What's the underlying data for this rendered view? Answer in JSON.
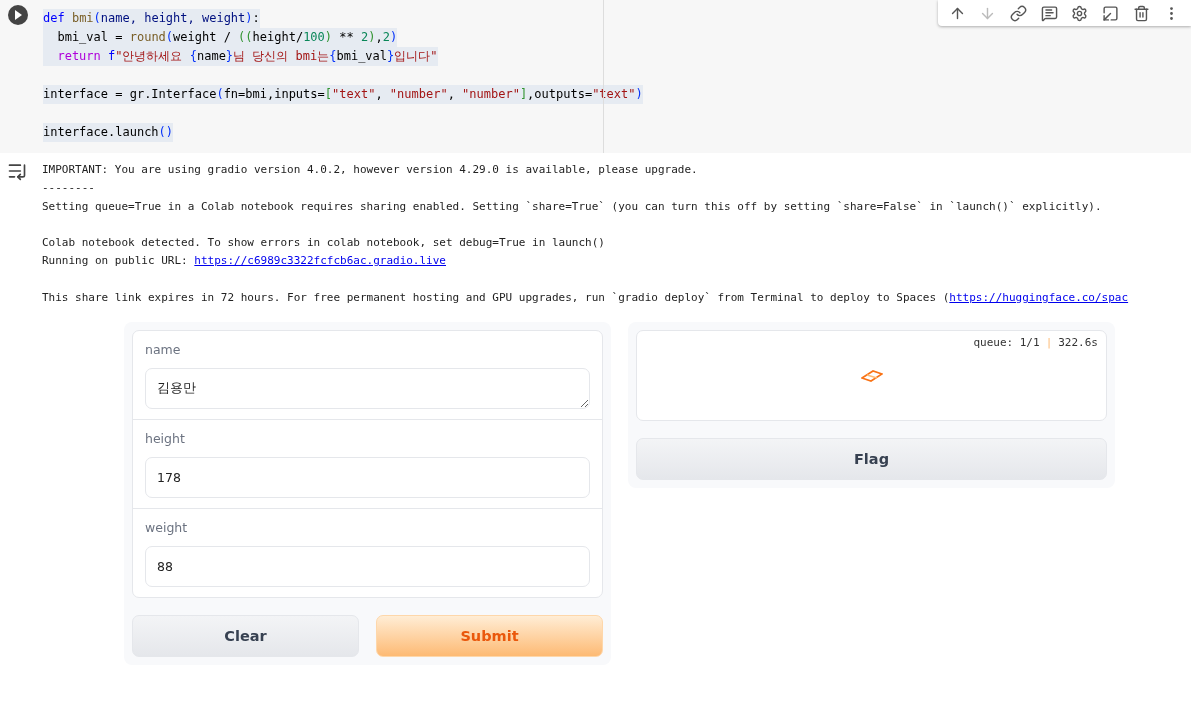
{
  "cell": {
    "code_blocks": [
      {
        "lines": [
          {
            "tokens": [
              {
                "text": "def ",
                "kind": "kw"
              },
              {
                "text": "bmi",
                "kind": "fn"
              },
              {
                "text": "(",
                "kind": "br"
              },
              {
                "text": "name, height, weight",
                "kind": "pm"
              },
              {
                "text": ")",
                "kind": "br"
              },
              {
                "text": ":",
                "kind": "tx"
              }
            ]
          },
          {
            "tokens": [
              {
                "text": "  bmi_val = ",
                "kind": "tx"
              },
              {
                "text": "round",
                "kind": "fn"
              },
              {
                "text": "(",
                "kind": "br"
              },
              {
                "text": "weight / ",
                "kind": "tx"
              },
              {
                "text": "((",
                "kind": "br2"
              },
              {
                "text": "height/",
                "kind": "tx"
              },
              {
                "text": "100",
                "kind": "num"
              },
              {
                "text": ")",
                "kind": "br2"
              },
              {
                "text": " ** ",
                "kind": "tx"
              },
              {
                "text": "2",
                "kind": "num"
              },
              {
                "text": ")",
                "kind": "br2"
              },
              {
                "text": ",",
                "kind": "tx"
              },
              {
                "text": "2",
                "kind": "num"
              },
              {
                "text": ")",
                "kind": "br"
              }
            ]
          },
          {
            "tokens": [
              {
                "text": "  return ",
                "kind": "ctl"
              },
              {
                "text": "f",
                "kind": "kw"
              },
              {
                "text": "\"안녕하세요 ",
                "kind": "str"
              },
              {
                "text": "{",
                "kind": "br"
              },
              {
                "text": "name",
                "kind": "tx"
              },
              {
                "text": "}",
                "kind": "br"
              },
              {
                "text": "님 당신의 bmi는",
                "kind": "str"
              },
              {
                "text": "{",
                "kind": "br"
              },
              {
                "text": "bmi_val",
                "kind": "tx"
              },
              {
                "text": "}",
                "kind": "br"
              },
              {
                "text": "입니다\"",
                "kind": "str"
              }
            ]
          }
        ]
      },
      {
        "lines": [
          {
            "tokens": [
              {
                "text": "interface = gr.Interface",
                "kind": "tx"
              },
              {
                "text": "(",
                "kind": "br"
              },
              {
                "text": "fn=bmi,inputs=",
                "kind": "tx"
              },
              {
                "text": "[",
                "kind": "br2"
              },
              {
                "text": "\"text\"",
                "kind": "str"
              },
              {
                "text": ", ",
                "kind": "tx"
              },
              {
                "text": "\"number\"",
                "kind": "str"
              },
              {
                "text": ", ",
                "kind": "tx"
              },
              {
                "text": "\"number\"",
                "kind": "str"
              },
              {
                "text": "]",
                "kind": "br2"
              },
              {
                "text": ",outputs=",
                "kind": "tx"
              },
              {
                "text": "\"text\"",
                "kind": "str"
              },
              {
                "text": ")",
                "kind": "br"
              }
            ]
          }
        ]
      },
      {
        "lines": [
          {
            "tokens": [
              {
                "text": "interface.launch",
                "kind": "tx"
              },
              {
                "text": "()",
                "kind": "br"
              }
            ]
          }
        ]
      }
    ],
    "toolbar": [
      {
        "kind": "up",
        "disabled": false
      },
      {
        "kind": "down",
        "disabled": true
      },
      {
        "kind": "link",
        "disabled": false
      },
      {
        "kind": "comment",
        "disabled": false
      },
      {
        "kind": "settings",
        "disabled": false
      },
      {
        "kind": "mirror",
        "disabled": false
      },
      {
        "kind": "delete",
        "disabled": false
      },
      {
        "kind": "more",
        "disabled": false
      }
    ]
  },
  "output_blocks": [
    {
      "lines": [
        {
          "text": "IMPORTANT: You are using gradio version 4.0.2, however version 4.29.0 is available, please upgrade."
        },
        {
          "text": "--------"
        },
        {
          "text": "Setting queue=True in a Colab notebook requires sharing enabled. Setting `share=True` (you can turn this off by setting `share=False` in `launch()` explicitly)."
        }
      ]
    },
    {
      "lines": [
        {
          "text": "Colab notebook detected. To show errors in colab notebook, set debug=True in launch()"
        },
        {
          "text": "Running on public URL: ",
          "link": "https://c6989c3322fcfcb6ac.gradio.live"
        }
      ]
    },
    {
      "lines": [
        {
          "text": "This share link expires in 72 hours. For free permanent hosting and GPU upgrades, run `gradio deploy` from Terminal to deploy to Spaces (",
          "link": "https://huggingface.co/spac"
        }
      ]
    }
  ],
  "app": {
    "inputs": [
      {
        "label": "name",
        "value": "김용만",
        "kind": "textarea"
      },
      {
        "label": "height",
        "value": "178",
        "kind": "number"
      },
      {
        "label": "weight",
        "value": "88",
        "kind": "number"
      }
    ],
    "buttons": [
      {
        "label": "Clear",
        "kind": "clear"
      },
      {
        "label": "Submit",
        "kind": "submit"
      }
    ],
    "status": {
      "queue": "queue: 1/1",
      "separator": "|",
      "time": "322.6s"
    },
    "flag_button": "Flag"
  }
}
